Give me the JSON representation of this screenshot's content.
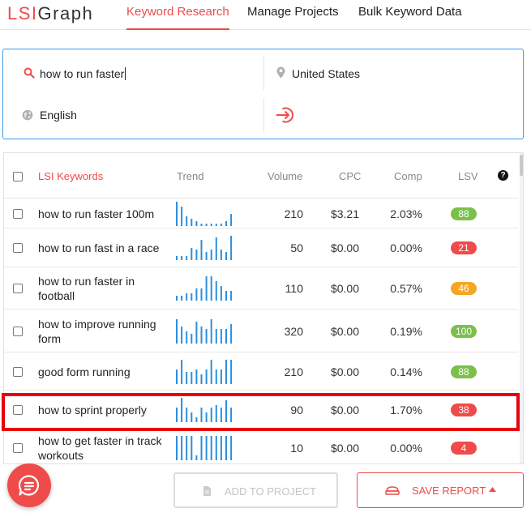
{
  "header": {
    "logo_lsi": "LSI",
    "logo_graph": "Graph",
    "tabs": [
      {
        "label": "Keyword Research",
        "active": true
      },
      {
        "label": "Manage Projects",
        "active": false
      },
      {
        "label": "Bulk Keyword Data",
        "active": false
      }
    ]
  },
  "search": {
    "query": "how to run faster",
    "country": "United States",
    "language": "English",
    "icons": {
      "query": "search-icon",
      "country": "location-pin-icon",
      "language": "globe-icon",
      "submit": "enter-arrow-icon"
    }
  },
  "table": {
    "headers": {
      "keyword": "LSI Keywords",
      "trend": "Trend",
      "volume": "Volume",
      "cpc": "CPC",
      "comp": "Comp",
      "lsv": "LSV",
      "help": "?"
    },
    "rows": [
      {
        "keyword": "how to run faster 100m",
        "trend": [
          10,
          8,
          4,
          3,
          2,
          1,
          1,
          1,
          1,
          1,
          2,
          5
        ],
        "volume": "210",
        "cpc": "$3.21",
        "comp": "2.03%",
        "lsv": "88",
        "lsv_color": "#7cc04b"
      },
      {
        "keyword": "how to run fast in a race",
        "trend": [
          2,
          2,
          2,
          6,
          5,
          10,
          4,
          5,
          11,
          5,
          4,
          12
        ],
        "volume": "50",
        "cpc": "$0.00",
        "comp": "0.00%",
        "lsv": "21",
        "lsv_color": "#ef4b4b"
      },
      {
        "keyword": "how to run faster in football",
        "trend": [
          2,
          2,
          3,
          3,
          5,
          5,
          10,
          10,
          8,
          6,
          4,
          4
        ],
        "volume": "110",
        "cpc": "$0.00",
        "comp": "0.57%",
        "lsv": "46",
        "lsv_color": "#f5a623"
      },
      {
        "keyword": "how to improve running form",
        "trend": [
          10,
          7,
          5,
          4,
          9,
          7,
          6,
          10,
          6,
          6,
          6,
          8
        ],
        "volume": "320",
        "cpc": "$0.00",
        "comp": "0.19%",
        "lsv": "100",
        "lsv_color": "#7cc04b"
      },
      {
        "keyword": "good form running",
        "trend": [
          6,
          10,
          5,
          5,
          6,
          4,
          6,
          10,
          6,
          6,
          10,
          10
        ],
        "volume": "210",
        "cpc": "$0.00",
        "comp": "0.14%",
        "lsv": "88",
        "lsv_color": "#7cc04b"
      },
      {
        "keyword": "how to sprint properly",
        "trend": [
          6,
          10,
          6,
          4,
          2,
          6,
          4,
          6,
          7,
          6,
          9,
          6
        ],
        "volume": "90",
        "cpc": "$0.00",
        "comp": "1.70%",
        "lsv": "38",
        "lsv_color": "#ef4b4b"
      },
      {
        "keyword": "how to get faster in track workouts",
        "trend": [
          10,
          10,
          10,
          10,
          2,
          10,
          10,
          10,
          10,
          10,
          10,
          10
        ],
        "volume": "10",
        "cpc": "$0.00",
        "comp": "0.00%",
        "lsv": "4",
        "lsv_color": "#ef4b4b"
      }
    ]
  },
  "actions": {
    "add_to_project": "ADD TO PROJECT",
    "save_report": "SAVE REPORT"
  },
  "colors": {
    "accent": "#ef4b4b",
    "trend_bar": "#2b8fdd",
    "focus_border": "#3b9bef",
    "highlight": "#e8000e"
  }
}
